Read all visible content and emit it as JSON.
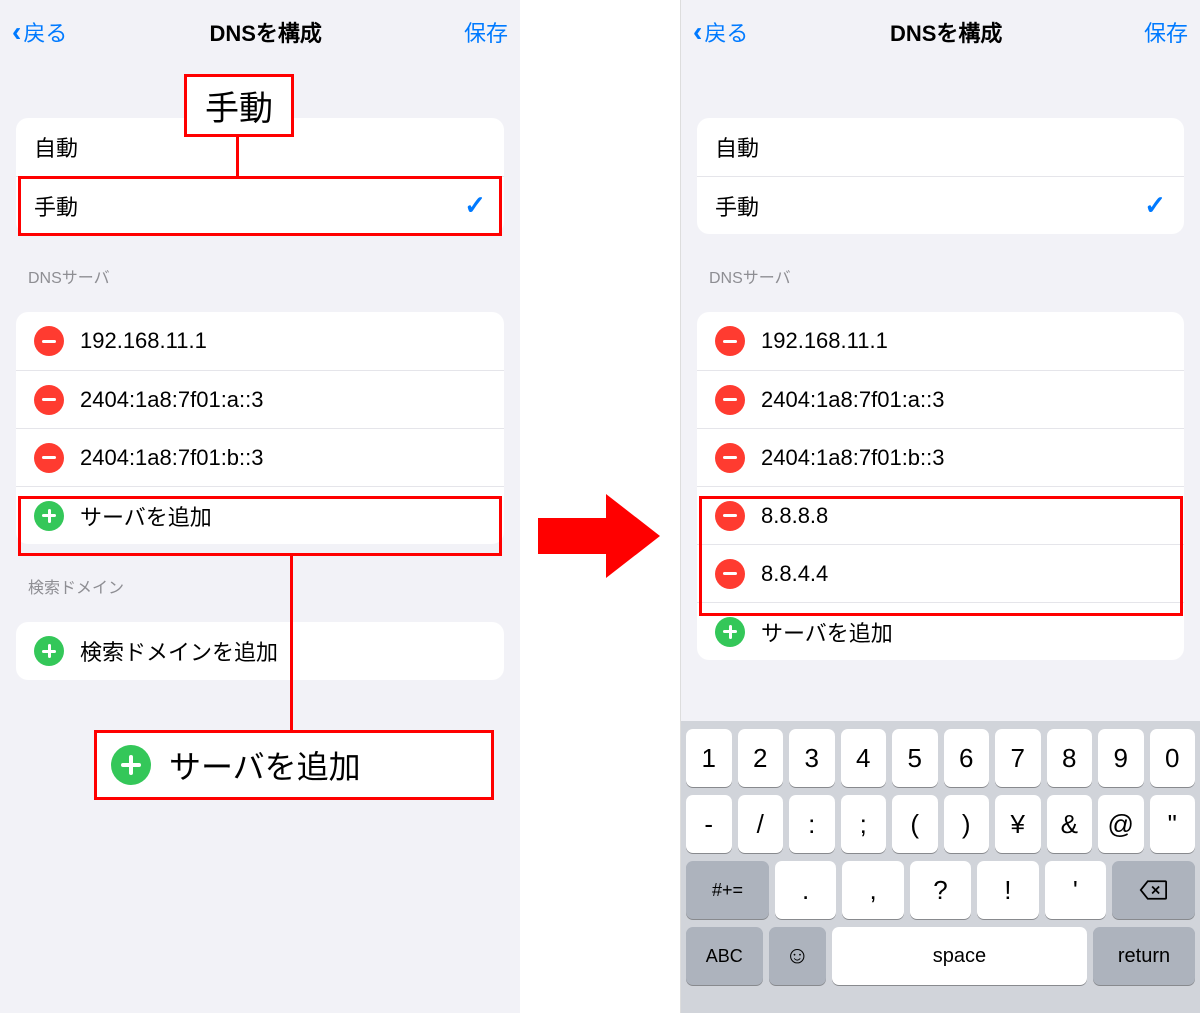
{
  "nav": {
    "back_label": "戻る",
    "title": "DNSを構成",
    "save_label": "保存"
  },
  "mode": {
    "auto_label": "自動",
    "manual_label": "手動"
  },
  "sections": {
    "dns_servers_header": "DNSサーバ",
    "search_domains_header": "検索ドメイン"
  },
  "left": {
    "servers": [
      "192.168.11.1",
      "2404:1a8:7f01:a::3",
      "2404:1a8:7f01:b::3"
    ],
    "add_server_label": "サーバを追加",
    "add_search_domain_label": "検索ドメインを追加"
  },
  "right": {
    "servers": [
      "192.168.11.1",
      "2404:1a8:7f01:a::3",
      "2404:1a8:7f01:b::3",
      "8.8.8.8",
      "8.8.4.4"
    ],
    "add_server_label": "サーバを追加"
  },
  "annotations": {
    "manual_callout": "手動",
    "add_server_callout": "サーバを追加"
  },
  "keyboard": {
    "row1": [
      "1",
      "2",
      "3",
      "4",
      "5",
      "6",
      "7",
      "8",
      "9",
      "0"
    ],
    "row2": [
      "-",
      "/",
      ":",
      ";",
      "(",
      ")",
      "¥",
      "&",
      "@",
      "\""
    ],
    "row3_shift": "#+=",
    "row3": [
      ".",
      ",",
      "?",
      "!",
      "'"
    ],
    "abc": "ABC",
    "space": "space",
    "return": "return"
  }
}
